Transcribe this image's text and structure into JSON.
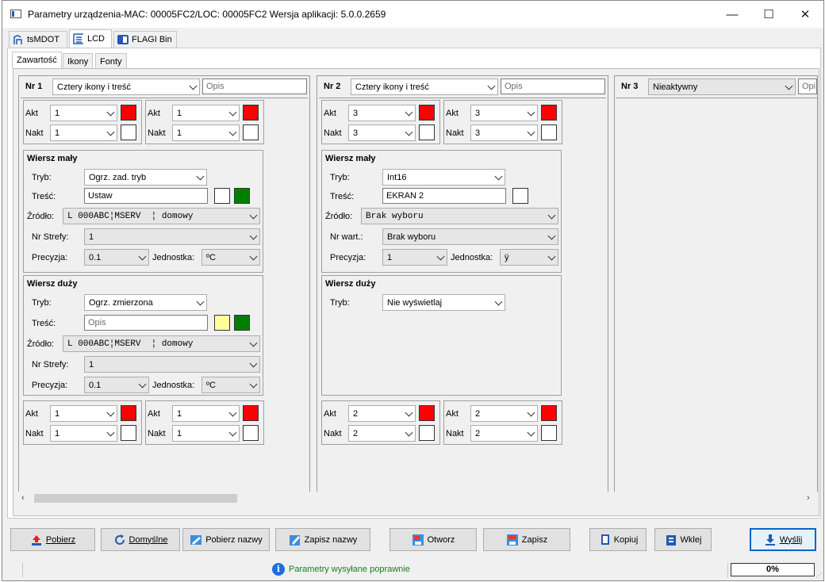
{
  "window": {
    "title": "Parametry urządzenia-MAC: 00005FC2/LOC: 00005FC2 Wersja aplikacji: 5.0.0.2659",
    "minimize": "—",
    "maximize": "☐",
    "close": "✕"
  },
  "main_tabs": [
    {
      "label": "tsMDOT"
    },
    {
      "label": "LCD"
    },
    {
      "label": "FLAGI Bin"
    }
  ],
  "sub_tabs": [
    {
      "label": "Zawartość"
    },
    {
      "label": "Ikony"
    },
    {
      "label": "Fonty"
    }
  ],
  "screens": [
    {
      "nr": "Nr 1",
      "mode": "Cztery ikony i treść",
      "opis": "Opis",
      "top_icons": [
        {
          "akt_label": "Akt",
          "akt": "1",
          "akt_color": "#ff0000",
          "nakt_label": "Nakt",
          "nakt": "1",
          "nakt_color": "#ffffff"
        },
        {
          "akt_label": "Akt",
          "akt": "1",
          "akt_color": "#ff0000",
          "nakt_label": "Nakt",
          "nakt": "1",
          "nakt_color": "#ffffff"
        }
      ],
      "small_row": {
        "title": "Wiersz mały",
        "tryb_label": "Tryb:",
        "tryb": "Ogrz. zad. tryb",
        "tresc_label": "Treść:",
        "tresc": "Ustaw",
        "color1": "#ffffff",
        "color2": "#008000",
        "zrodlo_label": "Źródło:",
        "zrodlo": "L 000ABC¦MSERV  ¦ domowy",
        "nr_label": "Nr Strefy:",
        "nr": "1",
        "precyzja_label": "Precyzja:",
        "precyzja": "0.1",
        "jednostka_label": "Jednostka:",
        "jednostka": "ºC"
      },
      "big_row": {
        "title": "Wiersz duży",
        "tryb_label": "Tryb:",
        "tryb": "Ogrz. zmierzona",
        "tresc_label": "Treść:",
        "tresc": "Opis",
        "color1": "#ffff99",
        "color2": "#008000",
        "zrodlo_label": "Źródło:",
        "zrodlo": "L 000ABC¦MSERV  ¦ domowy",
        "nr_label": "Nr Strefy:",
        "nr": "1",
        "precyzja_label": "Precyzja:",
        "precyzja": "0.1",
        "jednostka_label": "Jednostka:",
        "jednostka": "ºC"
      },
      "bottom_icons": [
        {
          "akt_label": "Akt",
          "akt": "1",
          "akt_color": "#ff0000",
          "nakt_label": "Nakt",
          "nakt": "1",
          "nakt_color": "#ffffff"
        },
        {
          "akt_label": "Akt",
          "akt": "1",
          "akt_color": "#ff0000",
          "nakt_label": "Nakt",
          "nakt": "1",
          "nakt_color": "#ffffff"
        }
      ]
    },
    {
      "nr": "Nr 2",
      "mode": "Cztery ikony i treść",
      "opis": "Opis",
      "top_icons": [
        {
          "akt_label": "Akt",
          "akt": "3",
          "akt_color": "#ff0000",
          "nakt_label": "Nakt",
          "nakt": "3",
          "nakt_color": "#ffffff"
        },
        {
          "akt_label": "Akt",
          "akt": "3",
          "akt_color": "#ff0000",
          "nakt_label": "Nakt",
          "nakt": "3",
          "nakt_color": "#ffffff"
        }
      ],
      "small_row": {
        "title": "Wiersz mały",
        "tryb_label": "Tryb:",
        "tryb": "Int16",
        "tresc_label": "Treść:",
        "tresc": "EKRAN 2",
        "color1": "#ffffff",
        "zrodlo_label": "Źródło:",
        "zrodlo": "Brak wyboru",
        "nr_label": "Nr wart.:",
        "nr": "Brak wyboru",
        "precyzja_label": "Precyzja:",
        "precyzja": "1",
        "jednostka_label": "Jednostka:",
        "jednostka": "ÿ"
      },
      "big_row": {
        "title": "Wiersz duży",
        "tryb_label": "Tryb:",
        "tryb": "Nie wyświetlaj"
      },
      "bottom_icons": [
        {
          "akt_label": "Akt",
          "akt": "2",
          "akt_color": "#ff0000",
          "nakt_label": "Nakt",
          "nakt": "2",
          "nakt_color": "#ffffff"
        },
        {
          "akt_label": "Akt",
          "akt": "2",
          "akt_color": "#ff0000",
          "nakt_label": "Nakt",
          "nakt": "2",
          "nakt_color": "#ffffff"
        }
      ]
    },
    {
      "nr": "Nr 3",
      "mode": "Nieaktywny",
      "opis": "Opi"
    }
  ],
  "buttons": {
    "pobierz": "Pobierz",
    "domyslne": "Domyślne",
    "pobierz_nazwy": "Pobierz nazwy",
    "zapisz_nazwy": "Zapisz nazwy",
    "otworz": "Otworz",
    "zapisz": "Zapisz",
    "kopiuj": "Kopiuj",
    "wklej": "Wklej",
    "wyslij": "Wyślij"
  },
  "status": {
    "message": "Parametry wysyłane poprawnie",
    "progress_text": "0%",
    "progress": 0
  }
}
